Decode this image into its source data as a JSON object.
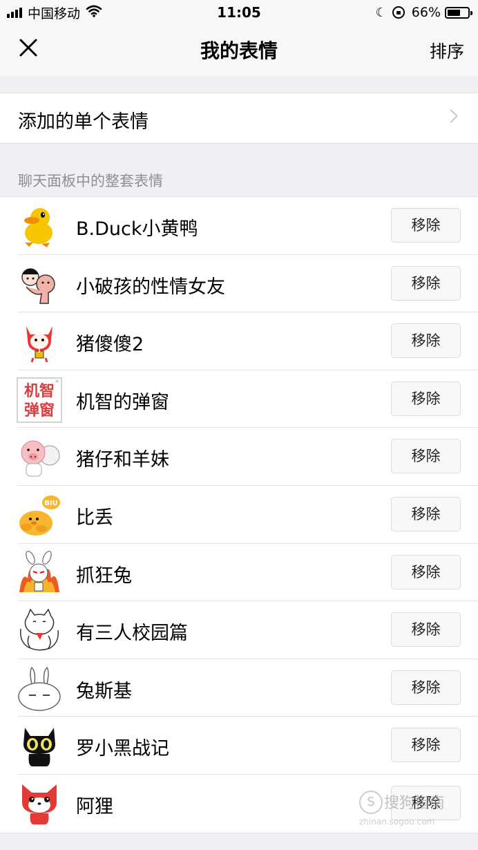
{
  "status_bar": {
    "carrier": "中国移动",
    "time": "11:05",
    "battery_percent": "66%",
    "battery_level": 0.66
  },
  "nav": {
    "title": "我的表情",
    "sort_label": "排序",
    "close_icon": "close-icon"
  },
  "single_emoji": {
    "label": "添加的单个表情"
  },
  "section": {
    "header": "聊天面板中的整套表情"
  },
  "packs": [
    {
      "name": "B.Duck小黄鸭",
      "remove_label": "移除",
      "icon": "duck"
    },
    {
      "name": "小破孩的性情女友",
      "remove_label": "移除",
      "icon": "kids"
    },
    {
      "name": "猪傻傻2",
      "remove_label": "移除",
      "icon": "pig-hood"
    },
    {
      "name": "机智的弹窗",
      "remove_label": "移除",
      "icon": "popup",
      "icon_text_1": "机智",
      "icon_text_2": "弹窗"
    },
    {
      "name": "猪仔和羊妹",
      "remove_label": "移除",
      "icon": "pig-sheep"
    },
    {
      "name": "比丢",
      "remove_label": "移除",
      "icon": "chick",
      "icon_text": "BIU"
    },
    {
      "name": "抓狂兔",
      "remove_label": "移除",
      "icon": "angry-rabbit"
    },
    {
      "name": "有三人校园篇",
      "remove_label": "移除",
      "icon": "cat"
    },
    {
      "name": "兔斯基",
      "remove_label": "移除",
      "icon": "tuzki"
    },
    {
      "name": "罗小黑战记",
      "remove_label": "移除",
      "icon": "black-cat"
    },
    {
      "name": "阿狸",
      "remove_label": "移除",
      "icon": "fox"
    }
  ],
  "watermark": {
    "logo_letter": "S",
    "text": "搜狗指南",
    "url": "zhinan.sogou.com"
  }
}
